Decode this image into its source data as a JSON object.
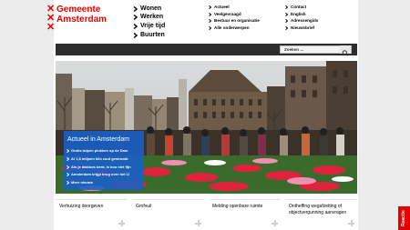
{
  "logo": {
    "line1": "Gemeente",
    "line2": "Amsterdam",
    "mark": "XXX"
  },
  "primary_nav": [
    {
      "label": "Wonen"
    },
    {
      "label": "Werken"
    },
    {
      "label": "Vrije tijd"
    },
    {
      "label": "Buurten"
    }
  ],
  "secondary_nav_left": [
    {
      "label": "Actueel"
    },
    {
      "label": "Veelgevraagd"
    },
    {
      "label": "Bestuur en organisatie"
    },
    {
      "label": "Alle onderwerpen"
    }
  ],
  "secondary_nav_right": [
    {
      "label": "Contact"
    },
    {
      "label": "English"
    },
    {
      "label": "Adressengids"
    },
    {
      "label": "Nieuwsbrief"
    }
  ],
  "search": {
    "placeholder": "Zoeken ..."
  },
  "news": {
    "title": "Actueel in Amsterdam",
    "items": [
      {
        "label": "Gratis tulpen plukken op de Dam"
      },
      {
        "label": "Al 1,8 miljoen kilo zout gestrooid"
      },
      {
        "label": "Als je dakloos bent, is kou niet fijn"
      },
      {
        "label": "Amsterdam krijgt brug over het IJ"
      },
      {
        "label": "Meer nieuws"
      }
    ]
  },
  "tiles": [
    {
      "label": "Verhuizing doorgeven"
    },
    {
      "label": "Grofvuil"
    },
    {
      "label": "Melding openbare ruimte"
    },
    {
      "label": "Ontheffing wegafzetting of objectvergunning aanvragen"
    }
  ],
  "feedback": {
    "label": "Reactie"
  },
  "colors": {
    "brand_red": "#ec0000",
    "nav_dark": "#2d2d2d",
    "news_blue": "#1960c4",
    "feedback_red": "#e40000"
  }
}
